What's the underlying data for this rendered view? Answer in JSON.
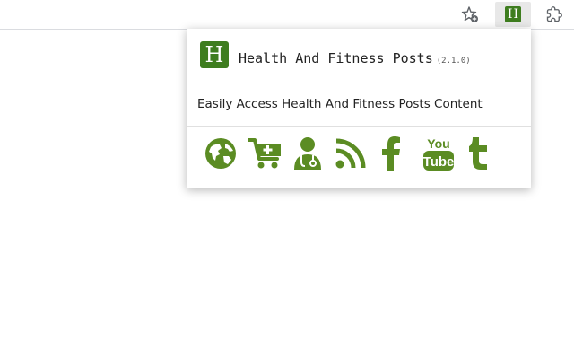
{
  "browser": {
    "extension_icon_letter": "H"
  },
  "popup": {
    "logo_letter": "H",
    "title": "Health And Fitness Posts",
    "version": "(2.1.0)",
    "description": "Easily Access Health And Fitness Posts Content",
    "links": [
      {
        "icon": "globe-icon"
      },
      {
        "icon": "shopping-cart-icon"
      },
      {
        "icon": "doctor-icon"
      },
      {
        "icon": "rss-icon"
      },
      {
        "icon": "facebook-icon"
      },
      {
        "icon": "youtube-icon",
        "text_top": "You",
        "text_bottom": "Tube"
      },
      {
        "icon": "tumblr-icon"
      }
    ]
  },
  "colors": {
    "brand_green": "#3e7d1f",
    "icon_green": "#5b8c23"
  }
}
